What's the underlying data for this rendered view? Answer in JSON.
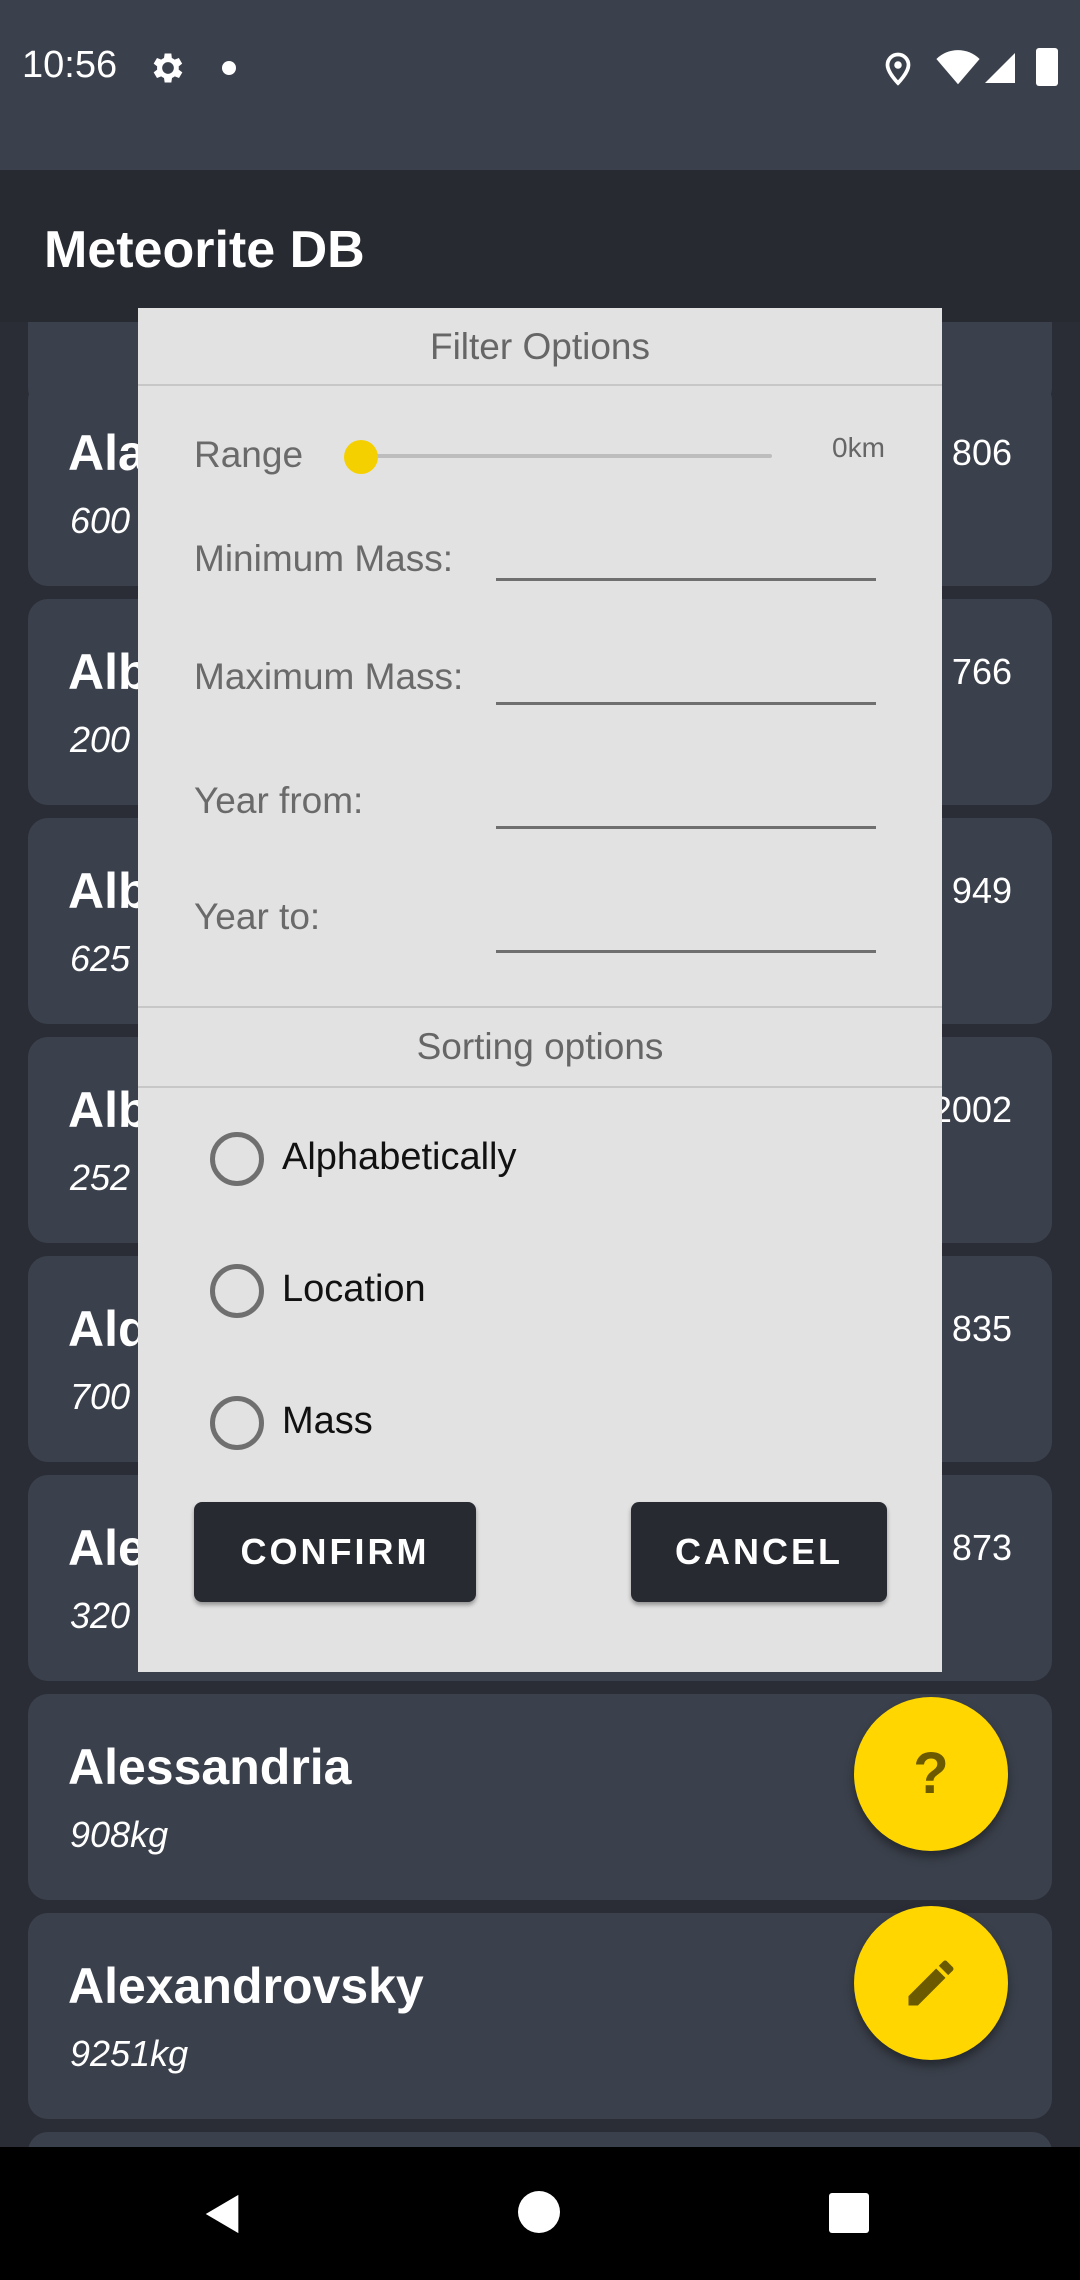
{
  "status_bar": {
    "time": "10:56",
    "icons": [
      "gear-icon",
      "notification-dot-icon",
      "location-icon",
      "wifi-icon",
      "cell-signal-icon",
      "battery-icon"
    ]
  },
  "app_bar": {
    "title": "Meteorite DB"
  },
  "list": {
    "items": [
      {
        "name": "Ala",
        "mass": "600",
        "year": "806"
      },
      {
        "name": "Alb",
        "mass": "200",
        "year": "766"
      },
      {
        "name": "Alb",
        "mass": "625",
        "year": "949"
      },
      {
        "name": "Alb",
        "mass": "252",
        "year": "2002"
      },
      {
        "name": "Ald",
        "mass": "700",
        "year": "835"
      },
      {
        "name": "Ale",
        "mass": "320",
        "year": "873"
      },
      {
        "name": "Alessandria",
        "mass": "908kg",
        "year": ""
      },
      {
        "name": "Alexandrovsky",
        "mass": "9251kg",
        "year": ""
      }
    ]
  },
  "dialog": {
    "filter_header": "Filter Options",
    "range_label": "Range",
    "range_value": "0km",
    "range_fraction": 0,
    "min_mass_label": "Minimum Mass:",
    "min_mass_value": "",
    "max_mass_label": "Maximum Mass:",
    "max_mass_value": "",
    "year_from_label": "Year from:",
    "year_from_value": "",
    "year_to_label": "Year to:",
    "year_to_value": "",
    "sorting_header": "Sorting options",
    "sort_options": [
      "Alphabetically",
      "Location",
      "Mass"
    ],
    "confirm_label": "CONFIRM",
    "cancel_label": "CANCEL"
  },
  "fabs": {
    "help_label": "?",
    "edit_icon": "pencil-icon"
  },
  "colors": {
    "accent": "#ffd600",
    "background": "#2a2d35",
    "card": "#3b414c",
    "dialog": "#e2e2e2",
    "button": "#272a31"
  }
}
